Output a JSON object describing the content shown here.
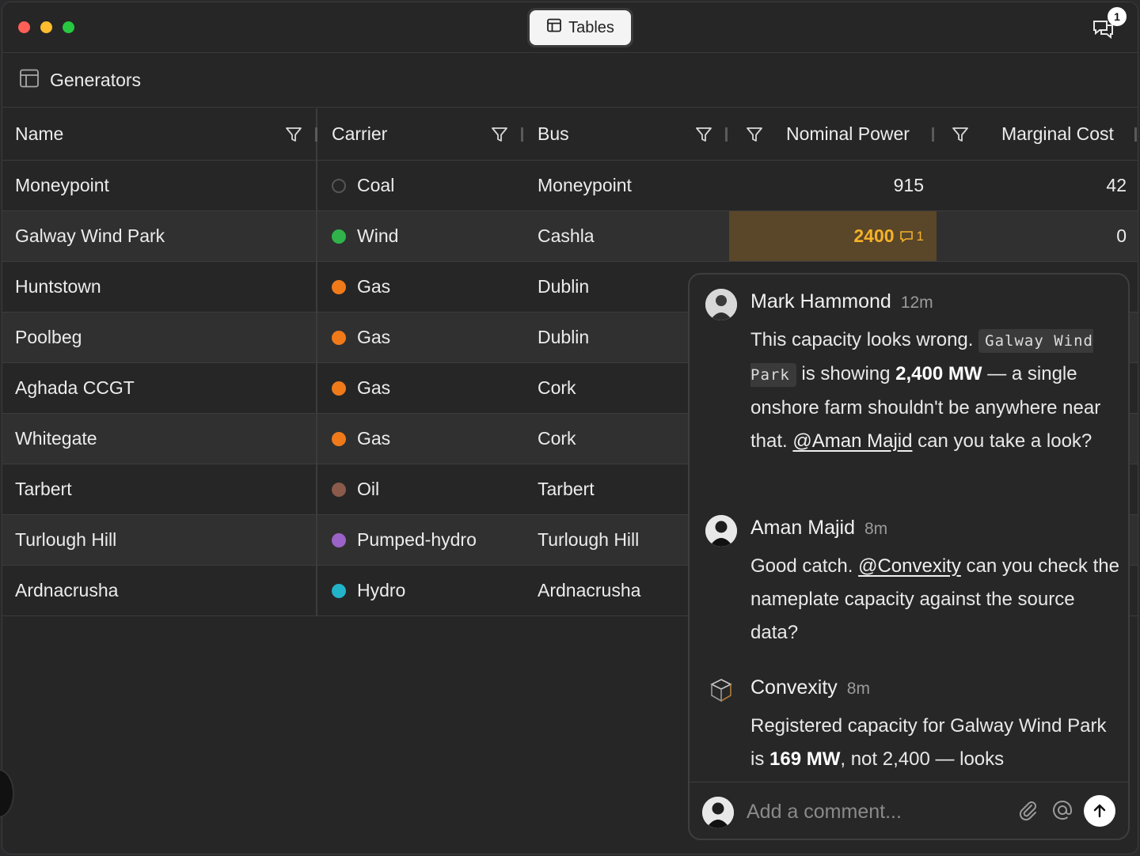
{
  "titlebar": {
    "center_button_label": "Tables",
    "notification_count": "1"
  },
  "header": {
    "title": "Generators"
  },
  "table": {
    "columns": {
      "name": "Name",
      "carrier": "Carrier",
      "bus": "Bus",
      "power": "Nominal Power",
      "cost": "Marginal Cost"
    },
    "rows": [
      {
        "name": "Moneypoint",
        "carrier": "Coal",
        "carrier_color": "hollow",
        "bus": "Moneypoint",
        "power": "915",
        "cost": "42"
      },
      {
        "name": "Galway Wind Park",
        "carrier": "Wind",
        "carrier_color": "#2fb34a",
        "bus": "Cashla",
        "power": "2400",
        "power_comments": "1",
        "cost": "0"
      },
      {
        "name": "Huntstown",
        "carrier": "Gas",
        "carrier_color": "#f07a1a",
        "bus": "Dublin",
        "power": "",
        "cost": ""
      },
      {
        "name": "Poolbeg",
        "carrier": "Gas",
        "carrier_color": "#f07a1a",
        "bus": "Dublin",
        "power": "",
        "cost": ""
      },
      {
        "name": "Aghada CCGT",
        "carrier": "Gas",
        "carrier_color": "#f07a1a",
        "bus": "Cork",
        "power": "",
        "cost": ""
      },
      {
        "name": "Whitegate",
        "carrier": "Gas",
        "carrier_color": "#f07a1a",
        "bus": "Cork",
        "power": "",
        "cost": ""
      },
      {
        "name": "Tarbert",
        "carrier": "Oil",
        "carrier_color": "#8a5a4a",
        "bus": "Tarbert",
        "power": "",
        "cost": ""
      },
      {
        "name": "Turlough Hill",
        "carrier": "Pumped-hydro",
        "carrier_color": "#9b62c8",
        "bus": "Turlough Hill",
        "power": "",
        "cost": ""
      },
      {
        "name": "Ardnacrusha",
        "carrier": "Hydro",
        "carrier_color": "#22b3c8",
        "bus": "Ardnacrusha",
        "power": "",
        "cost": ""
      }
    ]
  },
  "comments": [
    {
      "author": "Mark Hammond",
      "time": "12m",
      "parts": {
        "t1": "This capacity looks wrong. ",
        "code": "Galway Wind Park",
        "t2": " is showing ",
        "bold": "2,400 MW",
        "t3": " — a single onshore farm shouldn't be anywhere near that. ",
        "mention": "@Aman Majid",
        "t4": " can you take a look?"
      }
    },
    {
      "author": "Aman Majid",
      "time": "8m",
      "parts": {
        "t1": "Good catch. ",
        "mention": "@Convexity",
        "t2": " can you check the nameplate capacity against the source data?"
      }
    },
    {
      "author": "Convexity",
      "time": "8m",
      "parts": {
        "t1": "Registered capacity for Galway Wind Park is ",
        "bold": "169 MW",
        "t2": ", not 2,400 — looks"
      }
    }
  ],
  "composer": {
    "placeholder": "Add a comment..."
  }
}
